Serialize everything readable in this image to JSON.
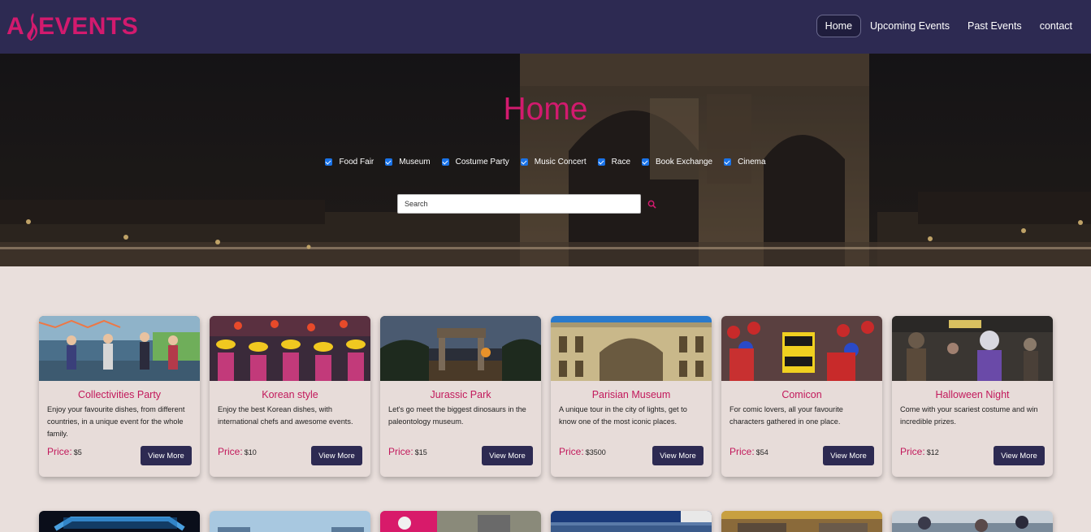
{
  "brand": {
    "logo_left": "A",
    "logo_right": "EVENTS",
    "color": "#d21a6e"
  },
  "nav": {
    "items": [
      {
        "label": "Home",
        "active": true
      },
      {
        "label": "Upcoming Events",
        "active": false
      },
      {
        "label": "Past Events",
        "active": false
      },
      {
        "label": "contact",
        "active": false
      }
    ]
  },
  "hero": {
    "title": "Home",
    "filters": [
      "Food Fair",
      "Museum",
      "Costume Party",
      "Music Concert",
      "Race",
      "Book Exchange",
      "Cinema"
    ],
    "search_placeholder": "Search",
    "search_icon": "search-icon"
  },
  "events": [
    {
      "title": "Collectivities Party",
      "desc": "Enjoy your favourite dishes, from different countries, in a unique event for the whole family.",
      "price_label": "Price:",
      "price": "$5",
      "button": "View More"
    },
    {
      "title": "Korean style",
      "desc": "Enjoy the best Korean dishes, with international chefs and awesome events.",
      "price_label": "Price:",
      "price": "$10",
      "button": "View More"
    },
    {
      "title": "Jurassic Park",
      "desc": "Let's go meet the biggest dinosaurs in the paleontology museum.",
      "price_label": "Price:",
      "price": "$15",
      "button": "View More"
    },
    {
      "title": "Parisian Museum",
      "desc": "A unique tour in the city of lights, get to know one of the most iconic places.",
      "price_label": "Price:",
      "price": "$3500",
      "button": "View More"
    },
    {
      "title": "Comicon",
      "desc": "For comic lovers, all your favourite characters gathered in one place.",
      "price_label": "Price:",
      "price": "$54",
      "button": "View More"
    },
    {
      "title": "Halloween Night",
      "desc": "Come with your scariest costume and win incredible prizes.",
      "price_label": "Price:",
      "price": "$12",
      "button": "View More"
    }
  ],
  "colors": {
    "navbar": "#2d2a52",
    "accent": "#d21a6e",
    "page_bg": "#e9dfdc",
    "button": "#2d2a52"
  }
}
